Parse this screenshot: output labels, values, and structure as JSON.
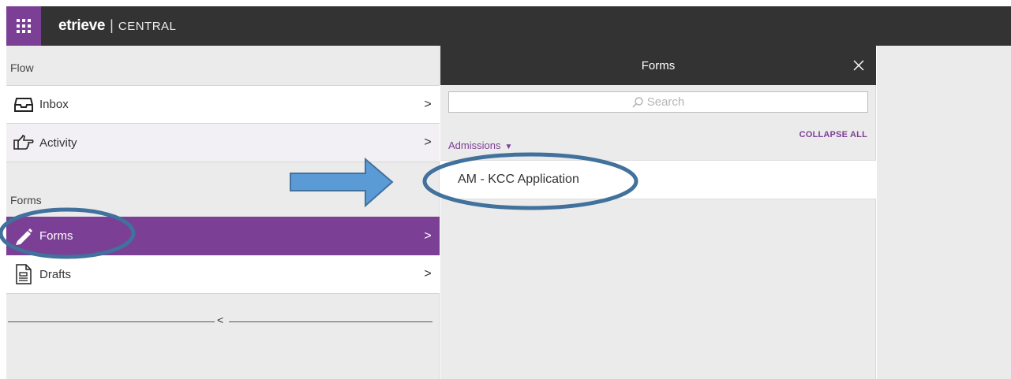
{
  "topbar": {
    "brand_logo": "etrieve",
    "brand_separator": "|",
    "brand_product": "CENTRAL",
    "apps_icon": "app-grid-icon"
  },
  "sidebar": {
    "flow_label": "Flow",
    "forms_label": "Forms",
    "items": [
      {
        "label": "Inbox",
        "icon": "inbox-icon",
        "chevron": ">"
      },
      {
        "label": "Activity",
        "icon": "pointing-hand-icon",
        "chevron": ">"
      },
      {
        "label": "Forms",
        "icon": "pencil-icon",
        "chevron": ">",
        "active": true
      },
      {
        "label": "Drafts",
        "icon": "document-icon",
        "chevron": ">"
      }
    ],
    "collapse_arrow": "<"
  },
  "forms_panel": {
    "title": "Forms",
    "close_icon": "close-icon",
    "search_placeholder": "Search",
    "collapse_all": "COLLAPSE ALL",
    "group_label": "Admissions",
    "group_caret": "▼",
    "items": [
      {
        "label": "AM - KCC Application"
      }
    ]
  },
  "colors": {
    "brand_purple": "#7b3f96",
    "header_dark": "#333333",
    "annotation_blue": "#5b9bd5",
    "annotation_outline": "#41719c"
  }
}
